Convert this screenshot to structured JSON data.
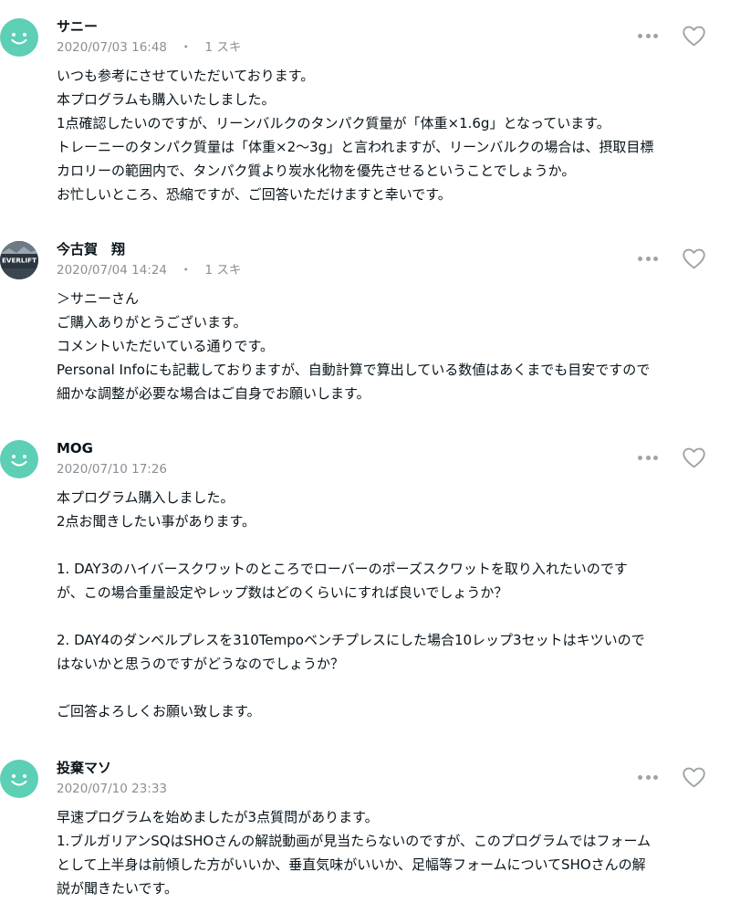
{
  "comments": [
    {
      "author": "サニー",
      "date": "2020/07/03 16:48",
      "likes": "1 スキ",
      "avatar_icon": "smiley-icon",
      "lines": [
        "いつも参考にさせていただいております。",
        "本プログラムも購入いたしました。",
        "1点確認したいのですが、リーンバルクのタンパク質量が「体重×1.6g」となっています。",
        "トレーニーのタンパク質量は「体重×2〜3g」と言われますが、リーンバルクの場合は、摂取目標",
        "カロリーの範囲内で、タンパク質より炭水化物を優先させるということでしょうか。",
        "お忙しいところ、恐縮ですが、ご回答いただけますと幸いです。"
      ]
    },
    {
      "author": "今古賀　翔",
      "date": "2020/07/04 14:24",
      "likes": "1 スキ",
      "avatar_icon": "everlift-logo-avatar",
      "avatar_text": "EVERLIFT",
      "lines": [
        "＞サニーさん",
        "ご購入ありがとうございます。",
        "コメントいただいている通りです。",
        "Personal Infoにも記載しておりますが、自動計算で算出している数値はあくまでも目安ですので",
        "細かな調整が必要な場合はご自身でお願いします。"
      ]
    },
    {
      "author": "MOG",
      "date": "2020/07/10 17:26",
      "likes": "",
      "avatar_icon": "smiley-icon",
      "lines": [
        "本プログラム購入しました。",
        "2点お聞きしたい事があります。",
        "",
        "1.  DAY3のハイバースクワットのところでローバーのポーズスクワットを取り入れたいのです",
        "が、この場合重量設定やレップ数はどのくらいにすれば良いでしょうか？",
        "",
        "2.  DAY4のダンベルプレスを310Tempoベンチプレスにした場合10レップ3セットはキツいので",
        "はないかと思うのですがどうなのでしょうか？",
        "",
        "ご回答よろしくお願い致します。"
      ]
    },
    {
      "author": "投棄マソ",
      "date": "2020/07/10 23:33",
      "likes": "",
      "avatar_icon": "smiley-icon",
      "lines": [
        "早速プログラムを始めましたが3点質問があります。",
        "1.ブルガリアンSQはSHOさんの解説動画が見当たらないのですが、このプログラムではフォーム",
        "として上半身は前傾した方がいいか、垂直気味がいいか、足幅等フォームについてSHOさんの解",
        "説が聞きたいです。"
      ]
    }
  ],
  "icons": {
    "more": "more-dots-icon",
    "like": "heart-outline-icon"
  },
  "colors": {
    "avatar": "#5ccfb4",
    "meta_text": "#8a8f94",
    "body_text": "#08131a",
    "icon": "#9ea3a7"
  }
}
